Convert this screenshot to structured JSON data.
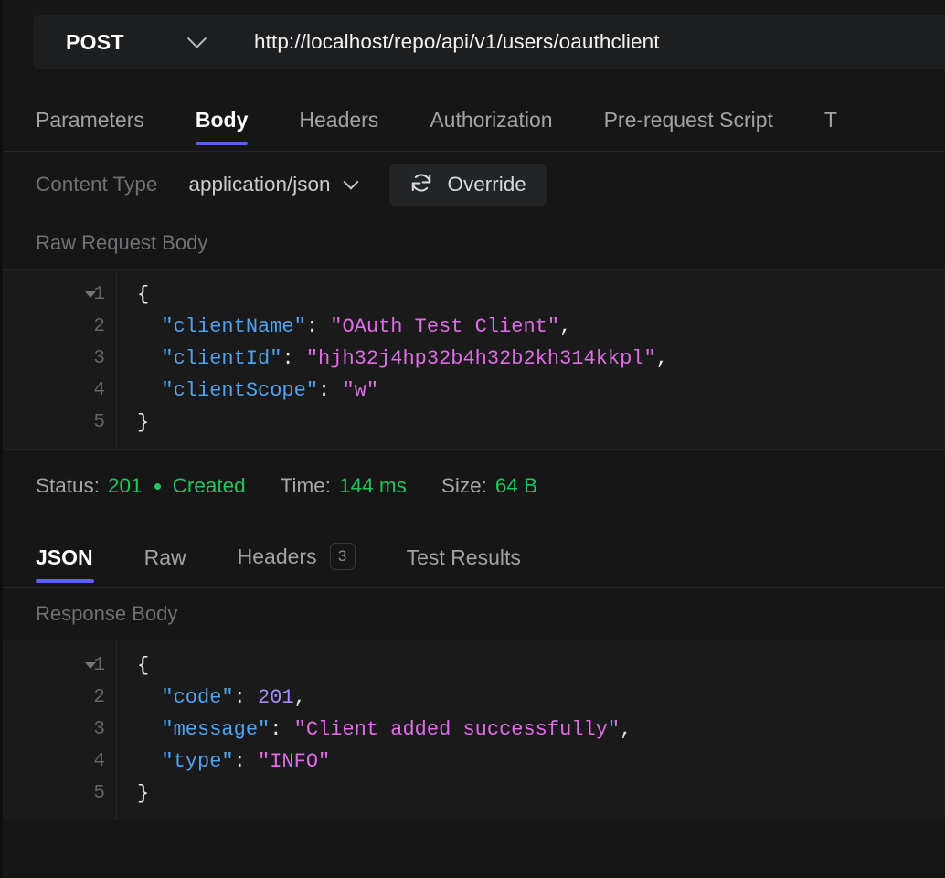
{
  "request": {
    "method": "POST",
    "url": "http://localhost/repo/api/v1/users/oauthclient",
    "tabs": [
      {
        "label": "Parameters",
        "active": false
      },
      {
        "label": "Body",
        "active": true
      },
      {
        "label": "Headers",
        "active": false
      },
      {
        "label": "Authorization",
        "active": false
      },
      {
        "label": "Pre-request Script",
        "active": false
      },
      {
        "label": "T",
        "active": false
      }
    ],
    "content_type_label": "Content Type",
    "content_type_value": "application/json",
    "override_label": "Override",
    "override_icon": "refresh-icon",
    "body_section_label": "Raw Request Body",
    "body_lines": [
      {
        "num": "1",
        "fold": true,
        "tokens": [
          {
            "t": "{",
            "c": "p"
          }
        ]
      },
      {
        "num": "2",
        "fold": false,
        "tokens": [
          {
            "t": "  \"clientName\"",
            "c": "k"
          },
          {
            "t": ": ",
            "c": "p"
          },
          {
            "t": "\"OAuth Test Client\"",
            "c": "s"
          },
          {
            "t": ",",
            "c": "p"
          }
        ]
      },
      {
        "num": "3",
        "fold": false,
        "tokens": [
          {
            "t": "  \"clientId\"",
            "c": "k"
          },
          {
            "t": ": ",
            "c": "p"
          },
          {
            "t": "\"hjh32j4hp32b4h32b2kh314kkpl\"",
            "c": "s"
          },
          {
            "t": ",",
            "c": "p"
          }
        ]
      },
      {
        "num": "4",
        "fold": false,
        "tokens": [
          {
            "t": "  \"clientScope\"",
            "c": "k"
          },
          {
            "t": ": ",
            "c": "p"
          },
          {
            "t": "\"w\"",
            "c": "s"
          }
        ]
      },
      {
        "num": "5",
        "fold": false,
        "tokens": [
          {
            "t": "}",
            "c": "p"
          }
        ]
      }
    ]
  },
  "response": {
    "status_key": "Status:",
    "status_code": "201",
    "status_text": "Created",
    "time_key": "Time:",
    "time_value": "144 ms",
    "size_key": "Size:",
    "size_value": "64 B",
    "tabs": [
      {
        "label": "JSON",
        "badge": "",
        "active": true
      },
      {
        "label": "Raw",
        "badge": "",
        "active": false
      },
      {
        "label": "Headers",
        "badge": "3",
        "active": false
      },
      {
        "label": "Test Results",
        "badge": "",
        "active": false
      }
    ],
    "body_section_label": "Response Body",
    "body_lines": [
      {
        "num": "1",
        "fold": true,
        "tokens": [
          {
            "t": "{",
            "c": "p"
          }
        ]
      },
      {
        "num": "2",
        "fold": false,
        "tokens": [
          {
            "t": "  \"code\"",
            "c": "k"
          },
          {
            "t": ": ",
            "c": "p"
          },
          {
            "t": "201",
            "c": "n"
          },
          {
            "t": ",",
            "c": "p"
          }
        ]
      },
      {
        "num": "3",
        "fold": false,
        "tokens": [
          {
            "t": "  \"message\"",
            "c": "k"
          },
          {
            "t": ": ",
            "c": "p"
          },
          {
            "t": "\"Client added successfully\"",
            "c": "s"
          },
          {
            "t": ",",
            "c": "p"
          }
        ]
      },
      {
        "num": "4",
        "fold": false,
        "tokens": [
          {
            "t": "  \"type\"",
            "c": "k"
          },
          {
            "t": ": ",
            "c": "p"
          },
          {
            "t": "\"INFO\"",
            "c": "s"
          }
        ]
      },
      {
        "num": "5",
        "fold": false,
        "tokens": [
          {
            "t": "}",
            "c": "p"
          }
        ]
      }
    ]
  },
  "colors": {
    "accent": "#5b5fe9",
    "success": "#22c55e",
    "json_key": "#4ea3f2",
    "json_string": "#e06ce8",
    "json_number": "#a78bfa",
    "background": "#161616",
    "editor_background": "#1a1a1a"
  }
}
